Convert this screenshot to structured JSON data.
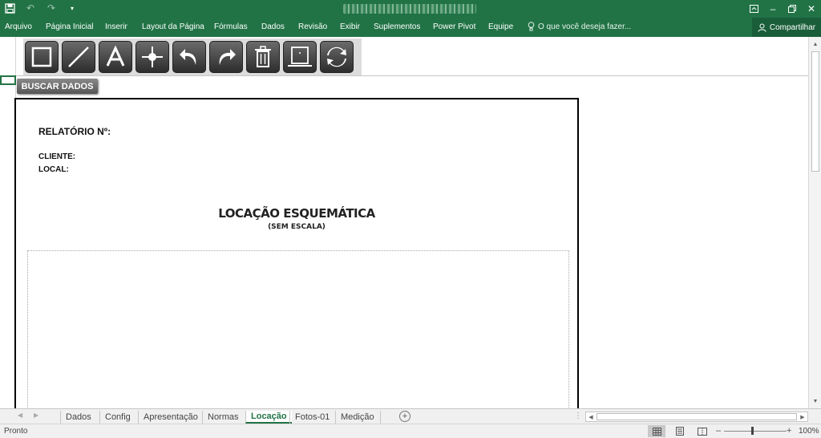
{
  "ribbon": {
    "tabs": [
      "Arquivo",
      "Página Inicial",
      "Inserir",
      "Layout da Página",
      "Fórmulas",
      "Dados",
      "Revisão",
      "Exibir",
      "Suplementos",
      "Power Pivot",
      "Equipe"
    ],
    "tell_me": "O que você deseja fazer...",
    "share": "Compartilhar"
  },
  "toolbar": {
    "buscar_dados": "BUSCAR DADOS"
  },
  "report": {
    "relatorio_label": "RELATÓRIO Nº:",
    "cliente_label": "CLIENTE:",
    "local_label": "LOCAL:",
    "title": "LOCAÇÃO ESQUEMÁTICA",
    "subtitle": "(SEM ESCALA)"
  },
  "sheet_tabs": [
    "Dados",
    "Config",
    "Apresentação",
    "Normas",
    "Locação",
    "Fotos-01",
    "Medição"
  ],
  "active_sheet": "Locação",
  "status": {
    "text": "Pronto",
    "zoom": "100%"
  },
  "colors": {
    "accent": "#217346"
  }
}
